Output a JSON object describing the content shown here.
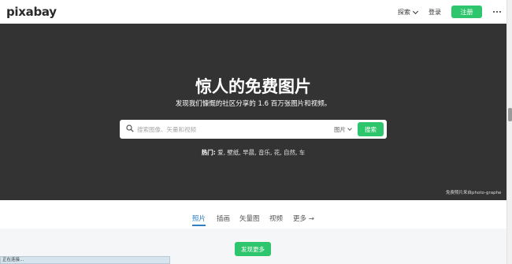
{
  "header": {
    "logo": "pixabay",
    "explore_label": "探索",
    "login_label": "登录",
    "register_label": "注册"
  },
  "hero": {
    "title": "惊人的免费图片",
    "subtitle": "发现我们慷慨的社区分享的 1.6 百万张图片和视频。",
    "search": {
      "placeholder": "搜索图像、矢量和视频",
      "type_label": "图片",
      "button_label": "搜索"
    },
    "trending_label": "热门:",
    "trending_items": "爱, 壁纸, 早晨, 音乐, 花, 自然, 车",
    "credit": "免费照片来自photo-graphe"
  },
  "tabs": [
    {
      "label": "照片",
      "active": true
    },
    {
      "label": "插画",
      "active": false
    },
    {
      "label": "矢量图",
      "active": false
    },
    {
      "label": "视频",
      "active": false
    },
    {
      "label": "更多 →",
      "active": false
    }
  ],
  "discover_label": "发现更多",
  "status_text": "正在连接...",
  "colors": {
    "accent_green": "#2ec66d",
    "hero_bg": "#333333",
    "active_tab": "#2e7fc5"
  }
}
